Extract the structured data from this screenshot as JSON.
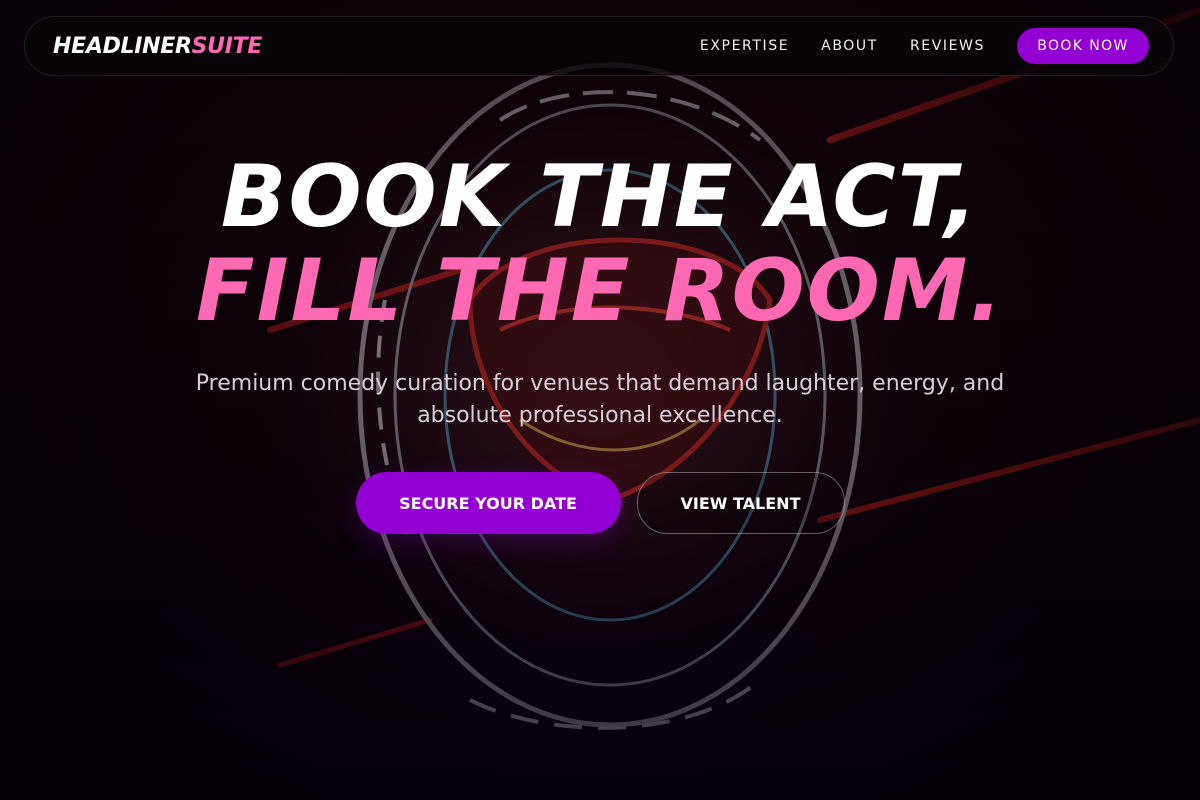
{
  "brand": {
    "name_main": "HEADLINER",
    "name_accent": "SUITE"
  },
  "nav": {
    "links": [
      "EXPERTISE",
      "ABOUT",
      "REVIEWS"
    ],
    "cta_label": "BOOK NOW"
  },
  "hero": {
    "headline_line1": "BOOK THE ACT,",
    "headline_line2": "FILL THE ROOM.",
    "subtitle": "Premium comedy curation for venues that demand laughter, energy, and absolute professional excellence.",
    "primary_cta": "SECURE YOUR DATE",
    "secondary_cta": "VIEW TALENT"
  },
  "colors": {
    "accent_pink": "#ff69b4",
    "accent_purple": "#9400d3",
    "background": "#0b0308"
  },
  "icons": {
    "background_art": "neon-comedy-sign-image"
  }
}
